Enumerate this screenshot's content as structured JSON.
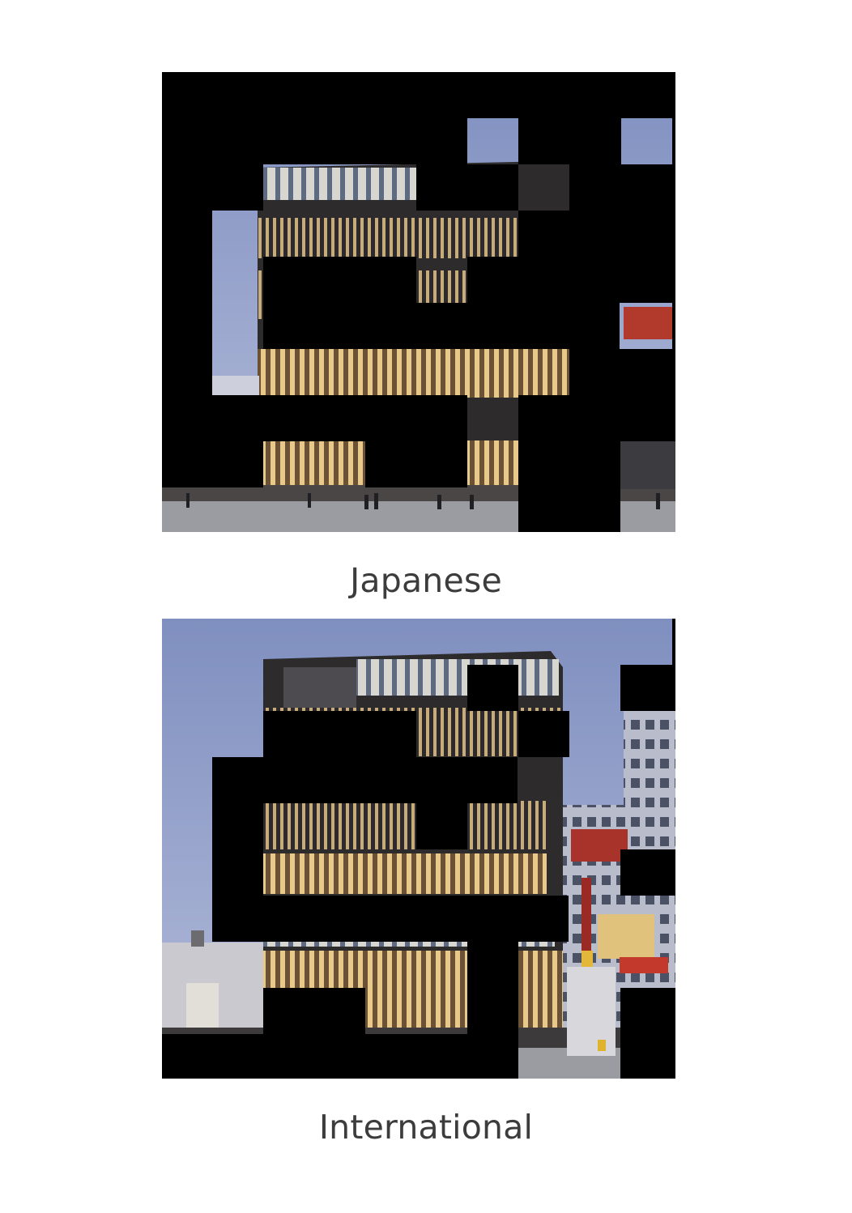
{
  "panels": [
    {
      "caption": "Japanese"
    },
    {
      "caption": "International"
    }
  ],
  "colors": {
    "mask": "#000000",
    "sky_top": "#7f8fbf",
    "sky_bottom": "#aab4d6",
    "facade_dark": "#3a3430",
    "facade_lit": "#c9a76a",
    "glass": "#6f7e96",
    "street": "#9a9aa0",
    "caption": "#3c3c3c"
  },
  "icons": [
    "building-photo",
    "mask-block"
  ]
}
